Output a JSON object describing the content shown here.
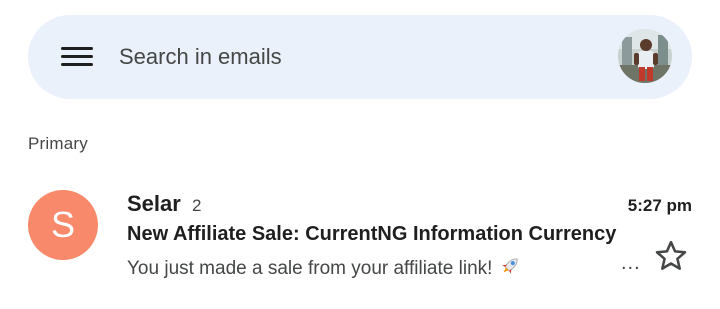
{
  "search": {
    "placeholder": "Search in emails",
    "value": ""
  },
  "icons": {
    "menu": "hamburger-menu-icon",
    "account": "account-avatar-photo",
    "star": "star-outline-icon",
    "snippet_emoji": "rocket-emoji"
  },
  "inbox": {
    "section_label": "Primary",
    "emails": [
      {
        "avatar_letter": "S",
        "avatar_color": "#f9896b",
        "sender": "Selar",
        "thread_count": "2",
        "time": "5:27 pm",
        "subject": "New Affiliate Sale: CurrentNG Information Currency",
        "snippet": "You just made a sale from your affiliate link!",
        "truncation": "...",
        "starred": false,
        "unread": true
      }
    ]
  },
  "colors": {
    "search_bar_bg": "#eaf1fb",
    "text_primary": "#1f1f1f",
    "text_secondary": "#444746"
  }
}
